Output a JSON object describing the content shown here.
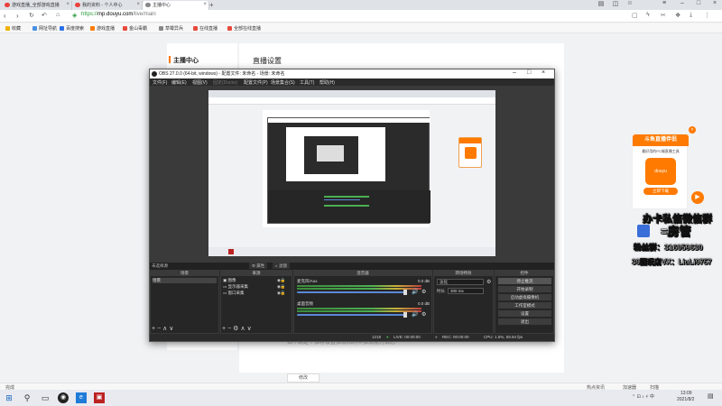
{
  "browser": {
    "tabs": [
      {
        "label": "游戏直播_全部游戏直播",
        "active": false
      },
      {
        "label": "我的资料 - 个人中心",
        "active": false
      },
      {
        "label": "主播中心",
        "active": true
      }
    ],
    "url_scheme": "https://",
    "url_host": "mp.douyu.com",
    "url_path": "/live/main",
    "bookmarks": [
      "收藏",
      "网址导航",
      "百度搜索",
      "游戏直播",
      "金山毒霸",
      "草霉异兵",
      "在线直播",
      "全部在线直播"
    ]
  },
  "page": {
    "sidebar_title": "主播中心",
    "content_title": "直播设置",
    "hint_text": "如不确定个推荐设置推流和码率推流能力请您",
    "modify_label": "修改"
  },
  "obs": {
    "title": "OBS 27.0.0 (64-bit, windows) - 配置文件: 未命名 - 场景: 未命名",
    "menu": [
      "文件(F)",
      "编辑(E)",
      "视图(V)",
      "固定(Docks)",
      "配置文件(P)",
      "场景集合(S)",
      "工具(T)",
      "帮助(H)"
    ],
    "no_source": "未选择源",
    "props_btn": "属性",
    "filters_btn": "滤镜",
    "docks": {
      "scenes": {
        "title": "场景",
        "items": [
          "场景"
        ]
      },
      "sources": {
        "title": "来源",
        "items": [
          "图像",
          "显示器采集",
          "窗口采集"
        ]
      },
      "mixer": {
        "title": "混音器",
        "channels": [
          {
            "name": "麦克风/Aux",
            "db": "0.0 dB"
          },
          {
            "name": "桌面音频",
            "db": "0.0 dB"
          }
        ]
      },
      "transitions": {
        "title": "转场特效",
        "type": "淡化",
        "duration_label": "时长",
        "duration_value": "300 ms"
      },
      "controls": {
        "title": "控件",
        "buttons": [
          "停止推流",
          "开始录制",
          "启动虚拟摄像机",
          "工作室模式",
          "设置",
          "退出"
        ]
      }
    },
    "status": {
      "live": "LIVE: 00:00:00",
      "rec": "REC: 00:00:00",
      "cpu": "CPU: 1.5%, 59.94 fps",
      "frames": "1218"
    }
  },
  "ad": {
    "title": "斗鱼直播伴侣",
    "desc": "最好用的PC端直播工具",
    "logo": "douyu",
    "button": "立即下载"
  },
  "overlay": {
    "line1": "办卡私信微信群",
    "line2": "=房管",
    "line3": "粉丝群：316059630",
    "line4": "39图玩店VX：LiuLi9757"
  },
  "statusbar": {
    "left": "完成",
    "items": [
      "热点资讯",
      "加速器",
      "扫描"
    ]
  },
  "taskbar": {
    "time": "13:09",
    "date": "2021/8/2"
  }
}
